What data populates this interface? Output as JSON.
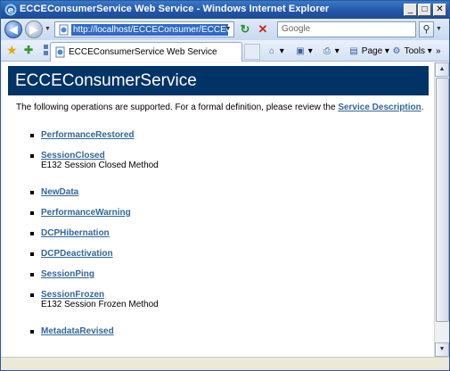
{
  "window": {
    "title": "ECCEConsumerService Web Service - Windows Internet Explorer"
  },
  "addressbar": {
    "url": "http://localhost/ECCEConsumer/ECCECons",
    "search_placeholder": "Google"
  },
  "tabs": [
    {
      "label": "ECCEConsumerService Web Service"
    }
  ],
  "command_bar": {
    "page_label": "Page",
    "tools_label": "Tools"
  },
  "page": {
    "heading": "ECCEConsumerService",
    "intro_text": "The following operations are supported. For a formal definition, please review the ",
    "intro_link": "Service Description",
    "intro_end": ".",
    "operations": [
      {
        "name": "PerformanceRestored",
        "description": ""
      },
      {
        "name": "SessionClosed",
        "description": "E132 Session Closed Method"
      },
      {
        "name": "NewData",
        "description": ""
      },
      {
        "name": "PerformanceWarning",
        "description": ""
      },
      {
        "name": "DCPHibernation",
        "description": ""
      },
      {
        "name": "DCPDeactivation",
        "description": ""
      },
      {
        "name": "SessionPing",
        "description": ""
      },
      {
        "name": "SessionFrozen",
        "description": "E132 Session Frozen Method"
      },
      {
        "name": "MetadataRevised",
        "description": ""
      }
    ]
  },
  "colors": {
    "heading_band": "#003366",
    "link": "#336699"
  }
}
